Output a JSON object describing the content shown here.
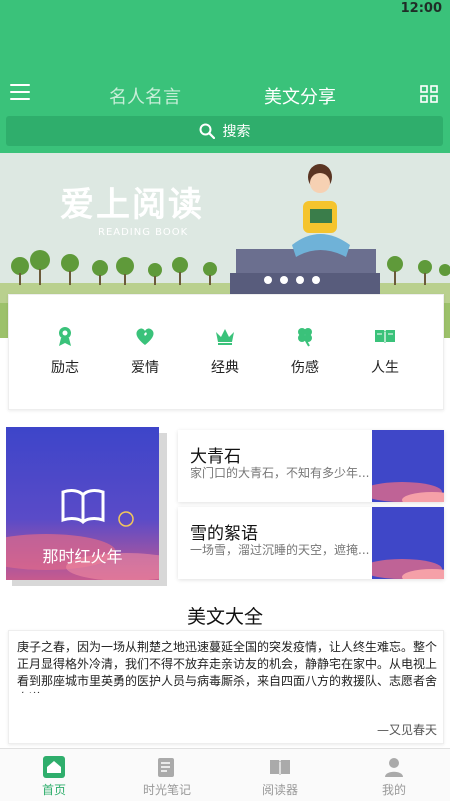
{
  "status_bar": {
    "time": "12:00"
  },
  "header": {
    "tabs": [
      {
        "label": "名人名言",
        "active": false
      },
      {
        "label": "美文分享",
        "active": true
      }
    ],
    "search": {
      "label": "搜索"
    },
    "accent_color": "#3ac27a"
  },
  "banner": {
    "title": "爱上阅读",
    "subtitle": "READING BOOK"
  },
  "categories": [
    {
      "label": "励志",
      "icon": "award-icon"
    },
    {
      "label": "爱情",
      "icon": "heart-icon"
    },
    {
      "label": "经典",
      "icon": "crown-icon"
    },
    {
      "label": "伤感",
      "icon": "clover-icon"
    },
    {
      "label": "人生",
      "icon": "book-icon"
    }
  ],
  "featured": {
    "title": "那时红火年",
    "icon": "open-book-icon"
  },
  "articles": [
    {
      "title": "大青石",
      "summary": "家门口的大青石，不知有多少年..."
    },
    {
      "title": "雪的絮语",
      "summary": "一场雪，溜过沉睡的天空，遮掩..."
    }
  ],
  "section": {
    "title": "美文大全"
  },
  "essay": {
    "body": "庚子之春，因为一场从荆楚之地迅速蔓延全国的突发疫情，让人终生难忘。整个正月显得格外冷清，我们不得不放弃走亲访友的机会，静静宅在家中。从电视上看到那座城市里英勇的医护人员与病毒厮杀，来自四面八方的救援队、志愿者舍身逆...",
    "source": "—又见春天"
  },
  "bottom_nav": [
    {
      "label": "首页",
      "icon": "home-icon",
      "active": true
    },
    {
      "label": "时光笔记",
      "icon": "notebook-icon",
      "active": false
    },
    {
      "label": "阅读器",
      "icon": "reader-icon",
      "active": false
    },
    {
      "label": "我的",
      "icon": "user-icon",
      "active": false
    }
  ]
}
